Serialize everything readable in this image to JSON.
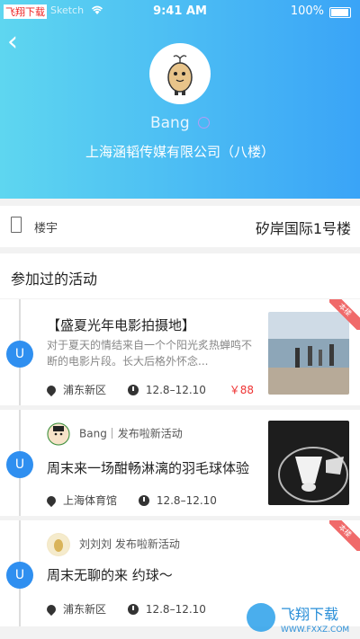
{
  "status_bar": {
    "carrier": "飞翔下载",
    "carrier2": "Sketch",
    "time": "9:41 AM",
    "battery": "100%"
  },
  "profile": {
    "name": "Bang",
    "company": "上海涵韬传媒有限公司（八楼）"
  },
  "building": {
    "label": "楼宇",
    "value": "矽岸国际1号楼"
  },
  "section_title": "参加过的活动",
  "cards": [
    {
      "title": "【盛夏光年电影拍摄地】",
      "description": "对于夏天的情结来自一个个阳光炙热蝉鸣不断的电影片段。长大后格外怀念...",
      "location": "浦东新区",
      "date": "12.8–12.10",
      "price": "￥88",
      "tag": "本楼",
      "thumb_alt": "beach"
    },
    {
      "user": "Bang｜发布啦新活动",
      "title": "周末来一场酣畅淋漓的羽毛球体验",
      "location": "上海体育馆",
      "date": "12.8–12.10",
      "thumb_alt": "badminton"
    },
    {
      "user": "刘刘刘 发布啦新活动",
      "title": "周末无聊的来 约球～",
      "location": "浦东新区",
      "date": "12.8–12.10",
      "tag": "本楼"
    }
  ],
  "watermark": {
    "text": "飞翔下载",
    "url": "WWW.FXXZ.COM"
  }
}
